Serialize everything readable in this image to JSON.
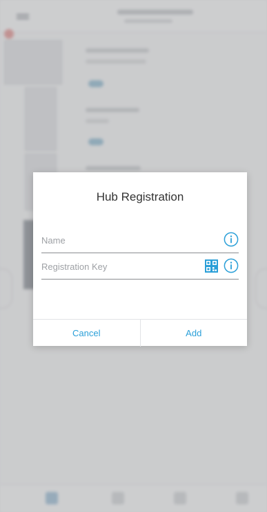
{
  "dialog": {
    "title": "Hub Registration",
    "name_field": {
      "placeholder": "Name",
      "value": "",
      "icon": "info-icon"
    },
    "key_field": {
      "placeholder": "Registration Key",
      "value": "",
      "icons": [
        "qr-code-icon",
        "info-icon"
      ]
    },
    "cancel_label": "Cancel",
    "add_label": "Add"
  },
  "colors": {
    "accent": "#2a9fd8",
    "qr_icon": "#2a9fd8",
    "title_text": "#333333",
    "placeholder_text": "#9ea1a5"
  }
}
